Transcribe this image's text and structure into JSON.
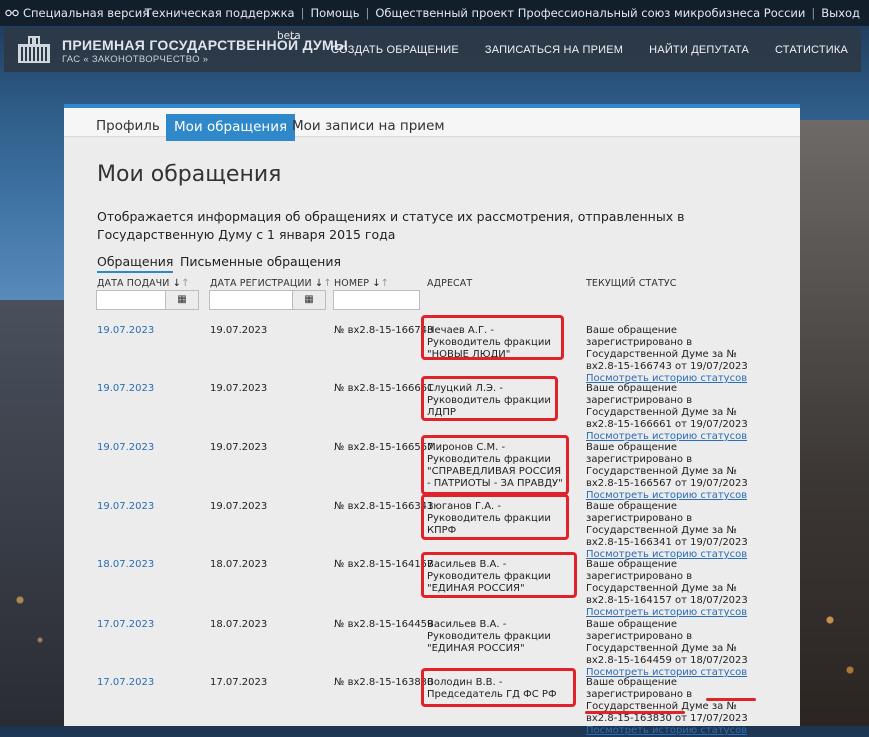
{
  "topbar": {
    "special_version": "Специальная версия",
    "links": [
      "Техническая поддержка",
      "Помощь",
      "Общественный проект Профессиональный союз микробизнеса России",
      "Выход"
    ]
  },
  "header": {
    "brand_line1": "ПРИЕМНАЯ ГОСУДАРСТВЕННОЙ ДУМЫ",
    "brand_line2": "ГАС « ЗАКОНОТВОРЧЕСТВО »",
    "beta": "beta",
    "nav": [
      "СОЗДАТЬ ОБРАЩЕНИЕ",
      "ЗАПИСАТЬСЯ НА ПРИЕМ",
      "НАЙТИ ДЕПУТАТА",
      "СТАТИСТИКА"
    ]
  },
  "tabs": [
    "Профиль",
    "Мои обращения",
    "Мои записи на прием"
  ],
  "page_title": "Мои обращения",
  "description": "Отображается информация об обращениях и статусе их рассмотрения, отправленных в Государственную Думу с 1 января 2015 года",
  "subtabs": [
    "Обращения",
    "Письменные обращения"
  ],
  "columns": {
    "date_submit": "ДАТА ПОДАЧИ",
    "date_reg": "ДАТА РЕГИСТРАЦИИ",
    "number": "НОМЕР",
    "addressee": "АДРЕСАТ",
    "status": "ТЕКУЩИЙ СТАТУС"
  },
  "sort_down": "↓",
  "sort_up": "↑",
  "calendar_glyph": "▦",
  "history_link": "Посмотреть историю статусов",
  "rows": [
    {
      "date_submit": "19.07.2023",
      "date_reg": "19.07.2023",
      "number": "№ вх2.8-15-166743",
      "addressee": "Нечаев А.Г. - Руководитель фракции \"НОВЫЕ ЛЮДИ\"",
      "status": "Ваше обращение зарегистрировано в Государственной Думе за № вх2.8-15-166743 от 19/07/2023"
    },
    {
      "date_submit": "19.07.2023",
      "date_reg": "19.07.2023",
      "number": "№ вх2.8-15-166661",
      "addressee": "Слуцкий Л.Э. - Руководитель фракции ЛДПР",
      "status": "Ваше обращение зарегистрировано в Государственной Думе за № вх2.8-15-166661 от 19/07/2023"
    },
    {
      "date_submit": "19.07.2023",
      "date_reg": "19.07.2023",
      "number": "№ вх2.8-15-166567",
      "addressee": "Миронов С.М. - Руководитель фракции \"СПРАВЕДЛИВАЯ РОССИЯ - ПАТРИОТЫ - ЗА ПРАВДУ\"",
      "status": "Ваше обращение зарегистрировано в Государственной Думе за № вх2.8-15-166567 от 19/07/2023"
    },
    {
      "date_submit": "19.07.2023",
      "date_reg": "19.07.2023",
      "number": "№ вх2.8-15-166341",
      "addressee": "Зюганов Г.А. - Руководитель фракции КПРФ",
      "status": "Ваше обращение зарегистрировано в Государственной Думе за № вх2.8-15-166341 от 19/07/2023"
    },
    {
      "date_submit": "18.07.2023",
      "date_reg": "18.07.2023",
      "number": "№ вх2.8-15-164157",
      "addressee": "Васильев В.А. - Руководитель фракции \"ЕДИНАЯ РОССИЯ\"",
      "status": "Ваше обращение зарегистрировано в Государственной Думе за № вх2.8-15-164157 от 18/07/2023"
    },
    {
      "date_submit": "17.07.2023",
      "date_reg": "18.07.2023",
      "number": "№ вх2.8-15-164459",
      "addressee": "Васильев В.А. - Руководитель фракции \"ЕДИНАЯ РОССИЯ\"",
      "status": "Ваше обращение зарегистрировано в Государственной Думе за № вх2.8-15-164459 от 18/07/2023"
    },
    {
      "date_submit": "17.07.2023",
      "date_reg": "17.07.2023",
      "number": "№ вх2.8-15-163830",
      "addressee": "Володин В.В. - Председатель ГД ФС РФ",
      "status": "Ваше обращение зарегистрировано в Государственной Думе за № вх2.8-15-163830 от 17/07/2023"
    }
  ]
}
